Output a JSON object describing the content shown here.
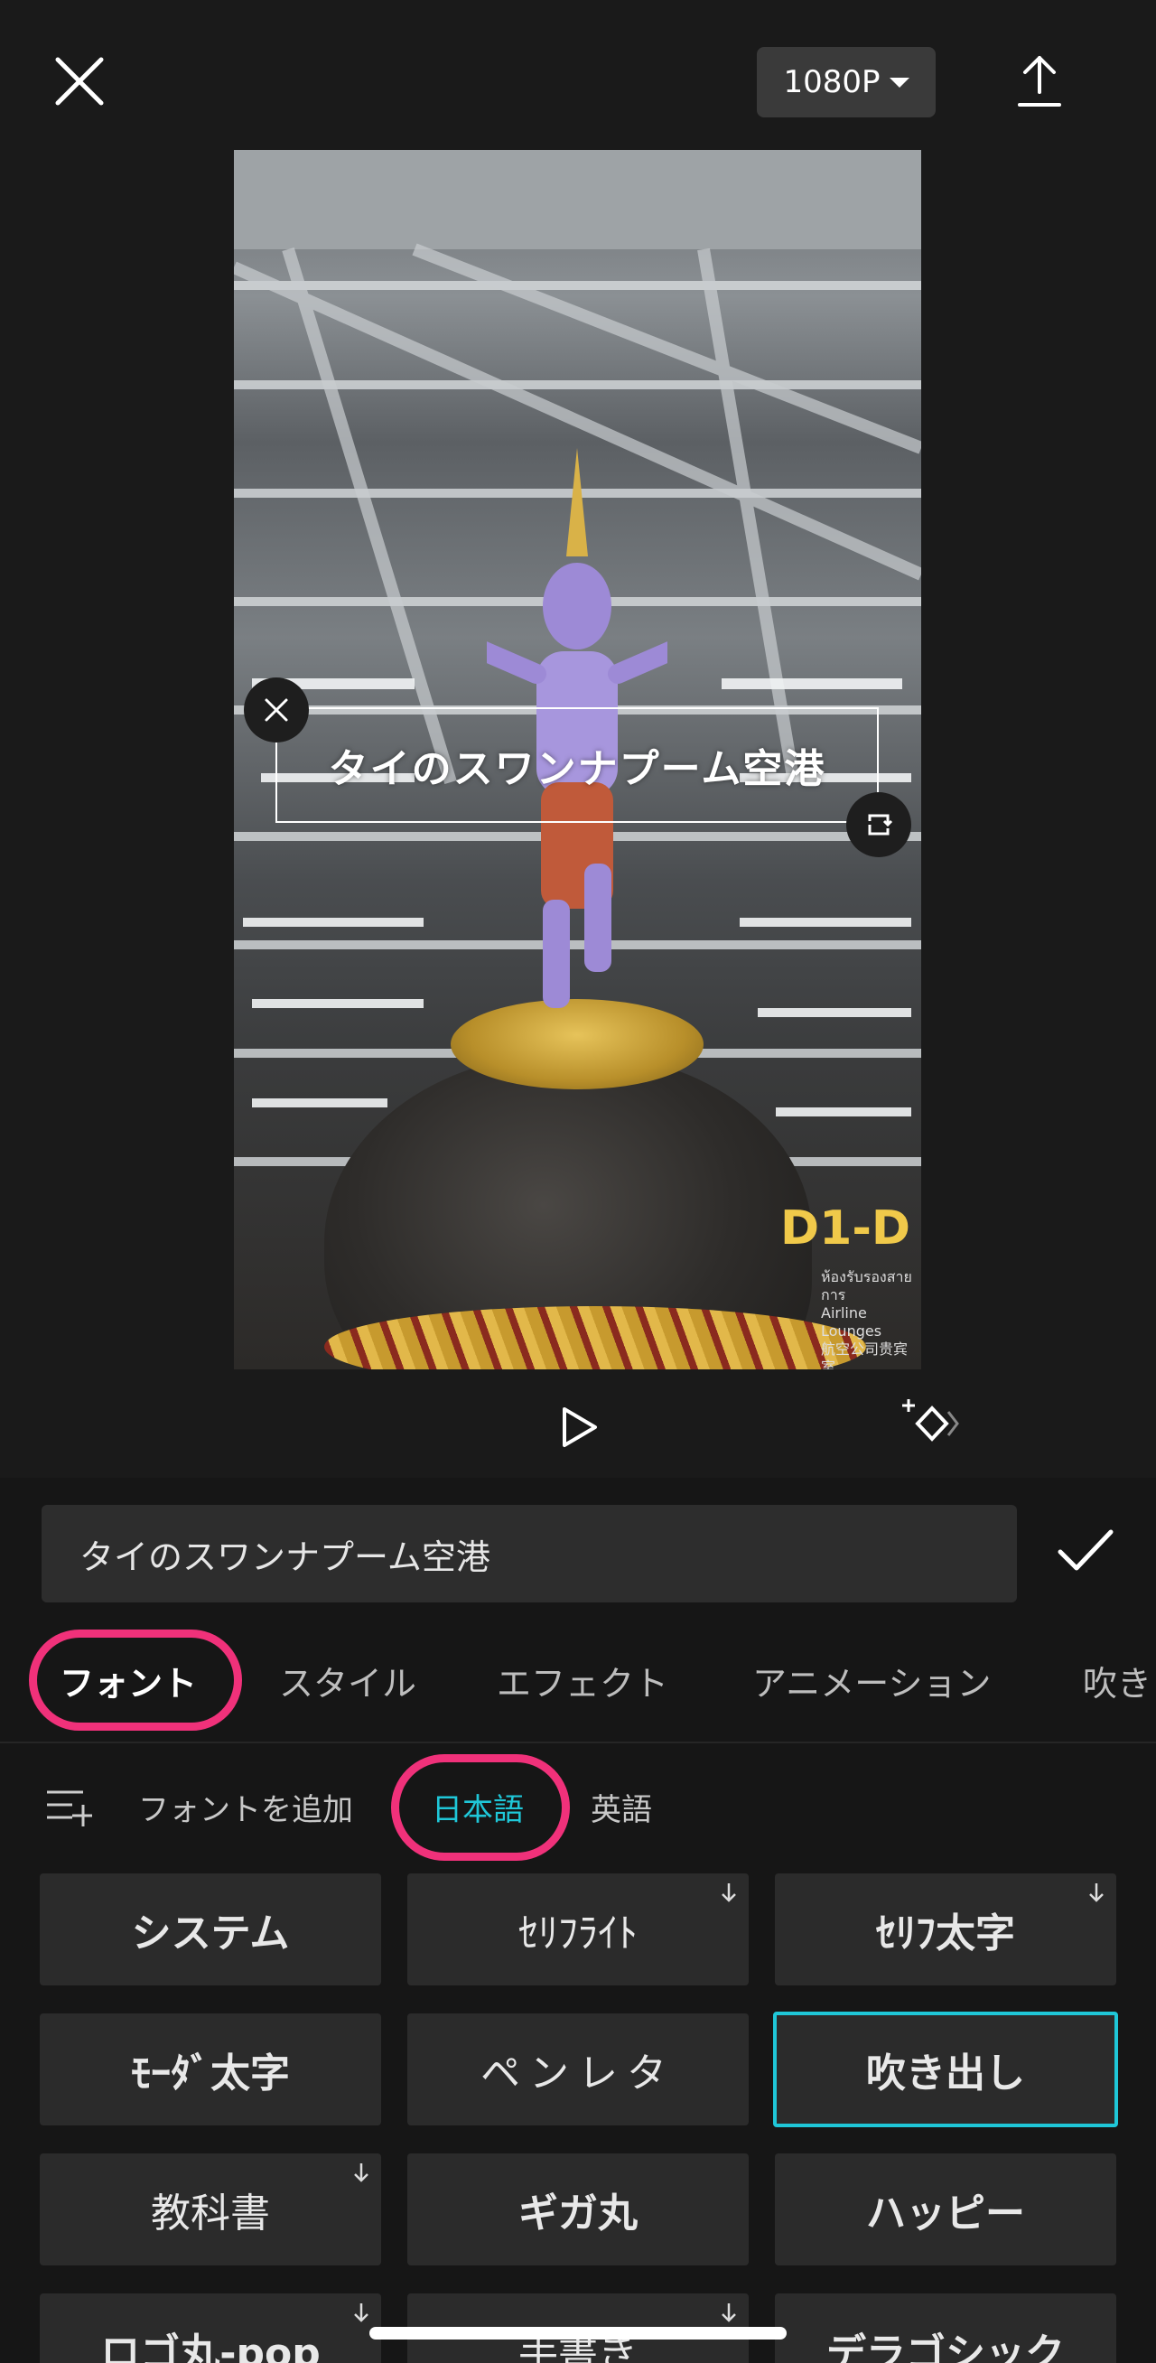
{
  "top_bar": {
    "resolution_label": "1080P"
  },
  "preview": {
    "overlay_text": "タイのスワンナプーム空港",
    "gate_sign": "D1-D",
    "gate_subtext": [
      "ห้องรับรองสายการ",
      "Airline Lounges",
      "航空公司贵宾室"
    ]
  },
  "editor": {
    "text_value": "タイのスワンナプーム空港"
  },
  "tabs": [
    {
      "label": "フォント",
      "active": true
    },
    {
      "label": "スタイル",
      "active": false
    },
    {
      "label": "エフェクト",
      "active": false
    },
    {
      "label": "アニメーション",
      "active": false
    },
    {
      "label": "吹き",
      "active": false
    }
  ],
  "font_subbar": {
    "add_font_label": "フォントを追加",
    "categories": [
      {
        "label": "日本語",
        "active": true
      },
      {
        "label": "英語",
        "active": false
      }
    ]
  },
  "fonts": [
    {
      "label": "システム",
      "download": false,
      "selected": false
    },
    {
      "label": "ｾﾘﾌﾗｲﾄ",
      "download": true,
      "selected": false
    },
    {
      "label": "ｾﾘﾌ太字",
      "download": true,
      "selected": false
    },
    {
      "label": "ﾓｰﾀﾞ太字",
      "download": false,
      "selected": false
    },
    {
      "label": "ペンレタ",
      "download": false,
      "selected": false
    },
    {
      "label": "吹き出し",
      "download": false,
      "selected": true
    },
    {
      "label": "教科書",
      "download": true,
      "selected": false
    },
    {
      "label": "ギガ丸",
      "download": false,
      "selected": false
    },
    {
      "label": "ハッピー",
      "download": false,
      "selected": false
    },
    {
      "label": "ロゴ丸-pop",
      "download": true,
      "selected": false
    },
    {
      "label": "手書き",
      "download": true,
      "selected": false
    },
    {
      "label": "デラゴシック",
      "download": false,
      "selected": false
    }
  ],
  "colors": {
    "accent": "#1fc7d8",
    "highlight_ring": "#f0317a",
    "panel_bg": "#161616"
  }
}
